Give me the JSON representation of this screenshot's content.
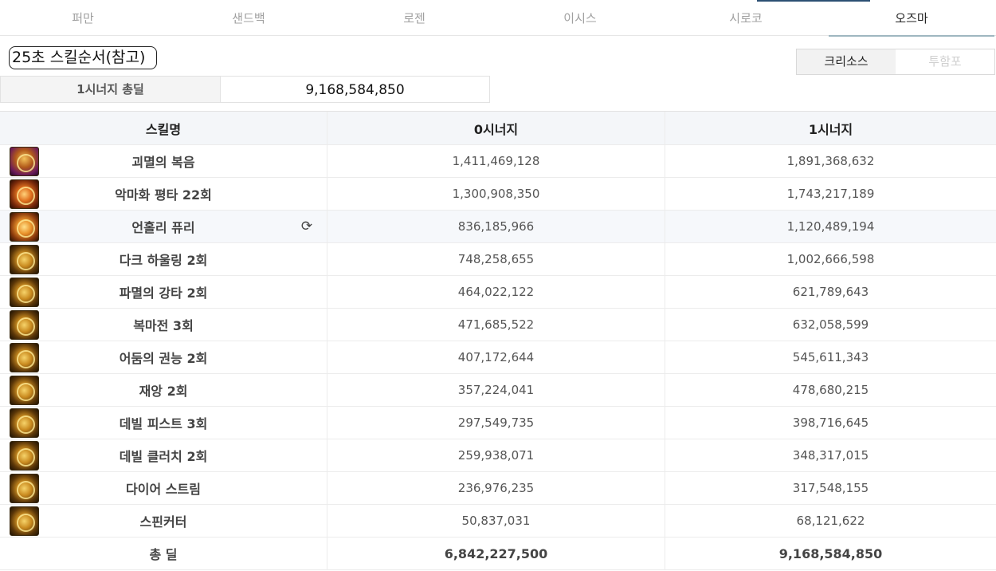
{
  "tabs": [
    {
      "label": "퍼만",
      "active": false
    },
    {
      "label": "샌드백",
      "active": false
    },
    {
      "label": "로젠",
      "active": false
    },
    {
      "label": "이시스",
      "active": false
    },
    {
      "label": "시로코",
      "active": false
    },
    {
      "label": "오즈마",
      "active": true
    }
  ],
  "title": "25초 스킬순서(참고)",
  "class_toggle": {
    "selected": "크리소스",
    "other": "투함포"
  },
  "summary": {
    "label": "1시너지 총딜",
    "value": "9,168,584,850"
  },
  "table": {
    "headers": [
      "스킬명",
      "0시너지",
      "1시너지"
    ],
    "rows": [
      {
        "name": "괴멸의 복음",
        "syn0": "1,411,469,128",
        "syn1": "1,891,368,632",
        "icon": "purple"
      },
      {
        "name": "악마화 평타 22회",
        "syn0": "1,300,908,350",
        "syn1": "1,743,217,189",
        "icon": "red"
      },
      {
        "name": "언홀리 퓨리",
        "syn0": "836,185,966",
        "syn1": "1,120,489,194",
        "icon": "orange",
        "refresh": true
      },
      {
        "name": "다크 하울링 2회",
        "syn0": "748,258,655",
        "syn1": "1,002,666,598",
        "icon": "gold"
      },
      {
        "name": "파멸의 강타 2회",
        "syn0": "464,022,122",
        "syn1": "621,789,643",
        "icon": "gold"
      },
      {
        "name": "복마전 3회",
        "syn0": "471,685,522",
        "syn1": "632,058,599",
        "icon": "gold"
      },
      {
        "name": "어둠의 권능 2회",
        "syn0": "407,172,644",
        "syn1": "545,611,343",
        "icon": "gold"
      },
      {
        "name": "재앙 2회",
        "syn0": "357,224,041",
        "syn1": "478,680,215",
        "icon": "gold"
      },
      {
        "name": "데빌 피스트 3회",
        "syn0": "297,549,735",
        "syn1": "398,716,645",
        "icon": "gold"
      },
      {
        "name": "데빌 클러치 2회",
        "syn0": "259,938,071",
        "syn1": "348,317,015",
        "icon": "gold"
      },
      {
        "name": "다이어 스트림",
        "syn0": "236,976,235",
        "syn1": "317,548,155",
        "icon": "gold"
      },
      {
        "name": "스핀커터",
        "syn0": "50,837,031",
        "syn1": "68,121,622",
        "icon": "gold"
      }
    ],
    "total": {
      "label": "총 딜",
      "syn0": "6,842,227,500",
      "syn1": "9,168,584,850"
    }
  }
}
